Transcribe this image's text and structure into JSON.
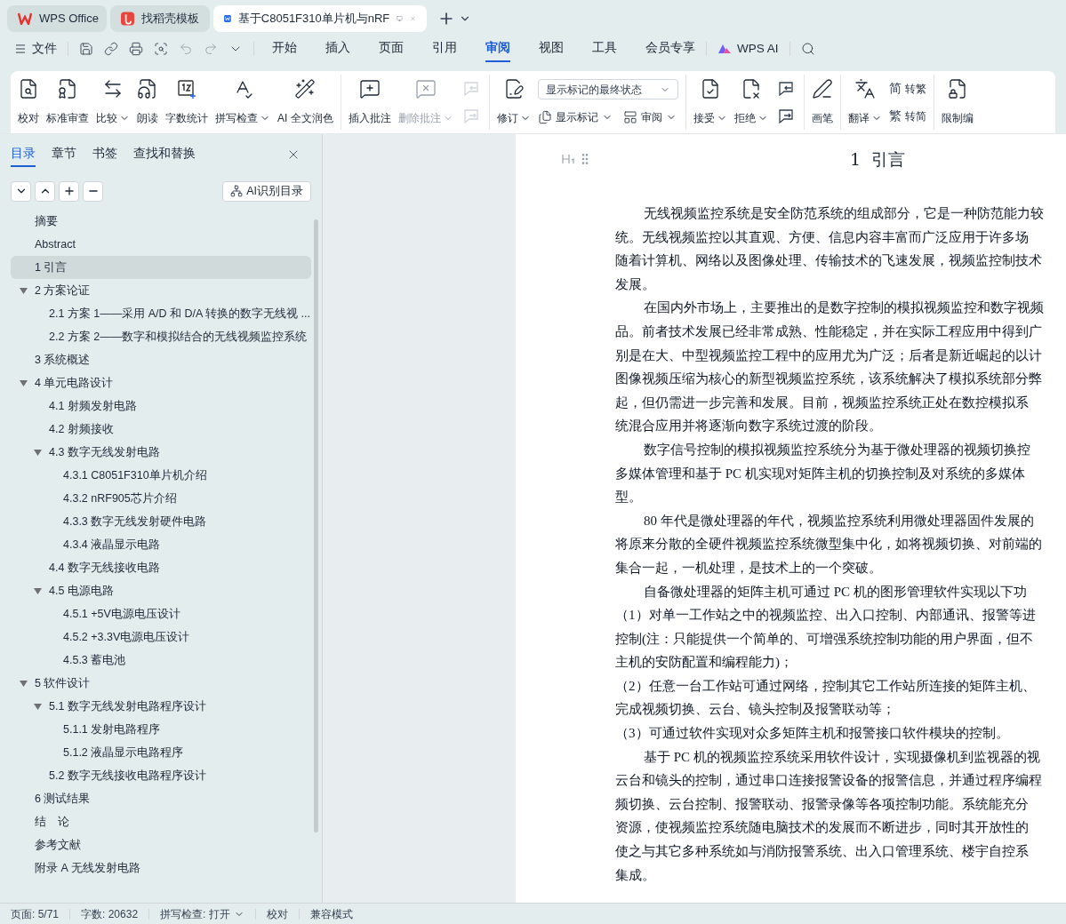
{
  "window_tabs": [
    {
      "label": "WPS Office",
      "selected": false
    },
    {
      "label": "找稻壳模板",
      "selected": false
    },
    {
      "label": "基于C8051F310单片机与nRF",
      "selected": true
    }
  ],
  "menu": {
    "file": "文件",
    "ai": "WPS AI",
    "tabs": [
      {
        "label": "开始",
        "selected": false
      },
      {
        "label": "插入",
        "selected": false
      },
      {
        "label": "页面",
        "selected": false
      },
      {
        "label": "引用",
        "selected": false
      },
      {
        "label": "审阅",
        "selected": true
      },
      {
        "label": "视图",
        "selected": false
      },
      {
        "label": "工具",
        "selected": false
      },
      {
        "label": "会员专享",
        "selected": false
      }
    ]
  },
  "ribbon": {
    "groups": [
      {
        "items": [
          {
            "label": "校对",
            "dropdown": false,
            "disabled": false
          },
          {
            "label": "标准审查",
            "dropdown": false,
            "disabled": false
          },
          {
            "label": "比较",
            "dropdown": true,
            "disabled": false
          },
          {
            "label": "朗读",
            "dropdown": false,
            "disabled": false
          },
          {
            "label": "字数统计",
            "dropdown": false,
            "disabled": false
          },
          {
            "label": "拼写检查",
            "dropdown": true,
            "disabled": false
          },
          {
            "label": "AI 全文润色",
            "dropdown": false,
            "disabled": false
          }
        ]
      },
      {
        "items": [
          {
            "label": "插入批注",
            "dropdown": false,
            "disabled": false
          },
          {
            "label": "删除批注",
            "dropdown": true,
            "disabled": true
          }
        ],
        "aside": [
          [
            {
              "kind": "nav",
              "disabled": true
            }
          ],
          [
            {
              "kind": "nav",
              "disabled": true
            }
          ]
        ]
      },
      {
        "items": [
          {
            "label": "修订",
            "dropdown": true,
            "disabled": false
          }
        ],
        "aside": [
          [
            {
              "kind": "select",
              "value": "显示标记的最终状态"
            }
          ],
          [
            {
              "kind": "small",
              "label": "显示标记",
              "dropdown": true
            },
            {
              "kind": "small",
              "label": "审阅",
              "dropdown": true
            }
          ]
        ]
      },
      {
        "items": [
          {
            "label": "接受",
            "dropdown": true,
            "disabled": false
          },
          {
            "label": "拒绝",
            "dropdown": true,
            "disabled": false
          }
        ],
        "aside": [
          [
            {
              "kind": "nav",
              "disabled": false
            }
          ],
          [
            {
              "kind": "nav",
              "disabled": false
            }
          ]
        ]
      },
      {
        "items": [
          {
            "label": "画笔",
            "dropdown": false,
            "disabled": false
          }
        ]
      },
      {
        "items": [
          {
            "label": "翻译",
            "dropdown": true,
            "disabled": false
          }
        ],
        "aside": [
          [
            {
              "kind": "small",
              "label": "转繁",
              "glyph": "简"
            }
          ],
          [
            {
              "kind": "small",
              "label": "转简",
              "glyph": "繁"
            }
          ]
        ]
      },
      {
        "items": [
          {
            "label": "限制编",
            "dropdown": false,
            "disabled": false
          }
        ]
      }
    ]
  },
  "sidebar": {
    "tabs": [
      {
        "label": "目录",
        "selected": true
      },
      {
        "label": "章节",
        "selected": false
      },
      {
        "label": "书签",
        "selected": false
      },
      {
        "label": "查找和替换",
        "selected": false
      }
    ],
    "ai_button": "AI识别目录",
    "toc": [
      {
        "label": "摘要",
        "selected": false
      },
      {
        "label": "Abstract",
        "selected": false
      },
      {
        "label": "1  引言",
        "selected": true
      },
      {
        "label": "2  方案论证",
        "selected": false,
        "expanded": true,
        "children": [
          {
            "label": "2.1  方案 1——采用 A/D 和 D/A 转换的数字无线视 ...",
            "selected": false
          },
          {
            "label": "2.2  方案 2——数字和模拟结合的无线视频监控系统",
            "selected": false
          }
        ]
      },
      {
        "label": "3  系统概述",
        "selected": false
      },
      {
        "label": "4  单元电路设计",
        "selected": false,
        "expanded": true,
        "children": [
          {
            "label": "4.1  射频发射电路",
            "selected": false
          },
          {
            "label": "4.2  射频接收",
            "selected": false
          },
          {
            "label": "4.3  数字无线发射电路",
            "selected": false,
            "expanded": true,
            "children": [
              {
                "label": "4.3.1 C8051F310单片机介绍",
                "selected": false
              },
              {
                "label": "4.3.2 nRF905芯片介绍",
                "selected": false
              },
              {
                "label": "4.3.3  数字无线发射硬件电路",
                "selected": false
              },
              {
                "label": "4.3.4  液晶显示电路",
                "selected": false
              }
            ]
          },
          {
            "label": "4.4  数字无线接收电路",
            "selected": false
          },
          {
            "label": "4.5  电源电路",
            "selected": false,
            "expanded": true,
            "children": [
              {
                "label": "4.5.1 +5V电源电压设计",
                "selected": false
              },
              {
                "label": "4.5.2 +3.3V电源电压设计",
                "selected": false
              },
              {
                "label": "4.5.3  蓄电池",
                "selected": false
              }
            ]
          }
        ]
      },
      {
        "label": "5  软件设计",
        "selected": false,
        "expanded": true,
        "children": [
          {
            "label": "5.1  数字无线发射电路程序设计",
            "selected": false,
            "expanded": true,
            "children": [
              {
                "label": "5.1.1  发射电路程序",
                "selected": false
              },
              {
                "label": "5.1.2  液晶显示电路程序",
                "selected": false
              }
            ]
          },
          {
            "label": "5.2  数字无线接收电路程序设计",
            "selected": false
          }
        ]
      },
      {
        "label": "6  测试结果",
        "selected": false
      },
      {
        "label": "结　论",
        "selected": false
      },
      {
        "label": "参考文献",
        "selected": false
      },
      {
        "label": "附录 A  无线发射电路",
        "selected": false
      }
    ]
  },
  "document": {
    "heading": "1  引言",
    "lines": [
      {
        "text": "无线视频监控系统是安全防范系统的组成部分，它是一种防范能力较",
        "indent": true
      },
      {
        "text": "统。无线视频监控以其直观、方便、信息内容丰富而广泛应用于许多场",
        "indent": false
      },
      {
        "text": "随着计算机、网络以及图像处理、传输技术的飞速发展，视频监控制技术",
        "indent": false
      },
      {
        "text": "发展。",
        "indent": false
      },
      {
        "text": "在国内外市场上，主要推出的是数字控制的模拟视频监控和数字视频",
        "indent": true
      },
      {
        "text": "品。前者技术发展已经非常成熟、性能稳定，并在实际工程应用中得到广",
        "indent": false
      },
      {
        "text": "别是在大、中型视频监控工程中的应用尤为广泛；后者是新近崛起的以计",
        "indent": false
      },
      {
        "text": "图像视频压缩为核心的新型视频监控系统，该系统解决了模拟系统部分弊",
        "indent": false
      },
      {
        "text": "起，但仍需进一步完善和发展。目前，视频监控系统正处在数控模拟系",
        "indent": false
      },
      {
        "text": "统混合应用并将逐渐向数字系统过渡的阶段。",
        "indent": false
      },
      {
        "text": "数字信号控制的模拟视频监控系统分为基于微处理器的视频切换控",
        "indent": true
      },
      {
        "text": "多媒体管理和基于 PC 机实现对矩阵主机的切换控制及对系统的多媒体",
        "indent": false
      },
      {
        "text": "型。",
        "indent": false
      },
      {
        "text": "80 年代是微处理器的年代，视频监控系统利用微处理器固件发展的",
        "indent": true
      },
      {
        "text": "将原来分散的全硬件视频监控系统微型集中化，如将视频切换、对前端的",
        "indent": false
      },
      {
        "text": "集合一起，一机处理，是技术上的一个突破。",
        "indent": false
      },
      {
        "text": "自备微处理器的矩阵主机可通过 PC 机的图形管理软件实现以下功",
        "indent": true
      },
      {
        "text": "（1）对单一工作站之中的视频监控、出入口控制、内部通讯、报警等进",
        "indent": false
      },
      {
        "text": "控制(注：只能提供一个简单的、可增强系统控制功能的用户界面，但不",
        "indent": false
      },
      {
        "text": "主机的安防配置和编程能力)；",
        "indent": false
      },
      {
        "text": "（2）任意一台工作站可通过网络，控制其它工作站所连接的矩阵主机、",
        "indent": false
      },
      {
        "text": "完成视频切换、云台、镜头控制及报警联动等；",
        "indent": false
      },
      {
        "text": "（3）可通过软件实现对众多矩阵主机和报警接口软件模块的控制。",
        "indent": false
      },
      {
        "text": "基于 PC 机的视频监控系统采用软件设计，实现摄像机到监视器的视",
        "indent": true
      },
      {
        "text": "云台和镜头的控制，通过串口连接报警设备的报警信息，并通过程序编程",
        "indent": false
      },
      {
        "text": "频切换、云台控制、报警联动、报警录像等各项控制功能。系统能充分",
        "indent": false
      },
      {
        "text": "资源，使视频监控系统随电脑技术的发展而不断进步，同时其开放性的",
        "indent": false
      },
      {
        "text": "使之与其它多种系统如与消防报警系统、出入口管理系统、楼宇自控系",
        "indent": false
      },
      {
        "text": "集成。",
        "indent": false
      }
    ]
  },
  "status_bar": [
    {
      "label": "页面: 5/71",
      "dropdown": false
    },
    {
      "label": "字数: 20632",
      "dropdown": false
    },
    {
      "label": "拼写检查: 打开",
      "dropdown": true
    },
    {
      "label": "校对",
      "dropdown": false
    },
    {
      "label": "兼容模式",
      "dropdown": false
    }
  ]
}
